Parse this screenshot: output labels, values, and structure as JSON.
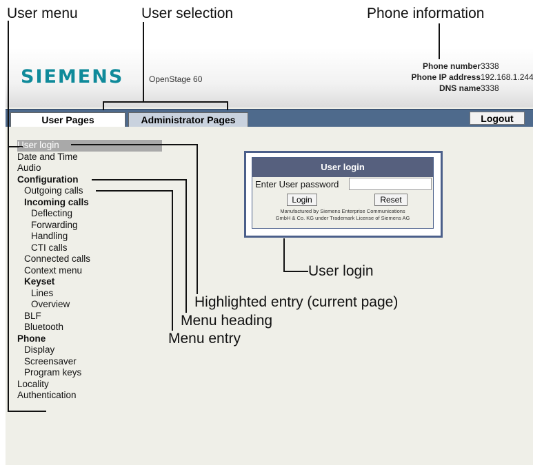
{
  "callouts": {
    "user_menu": "User menu",
    "user_selection": "User selection",
    "phone_information": "Phone information",
    "user_login": "User login",
    "highlighted_entry": "Highlighted entry (current page)",
    "menu_heading": "Menu heading",
    "menu_entry": "Menu entry"
  },
  "header": {
    "logo": "SIEMENS",
    "model": "OpenStage 60",
    "phone_info": [
      {
        "label": "Phone number",
        "value": "3338"
      },
      {
        "label": "Phone IP address",
        "value": "192.168.1.244"
      },
      {
        "label": "DNS name",
        "value": "3338"
      }
    ]
  },
  "tabs": {
    "user_pages": "User Pages",
    "admin_pages": "Administrator Pages",
    "logout": "Logout"
  },
  "menu": {
    "items": [
      {
        "label": "User login",
        "level": 1,
        "bold": false,
        "highlighted": true
      },
      {
        "label": "Date and Time",
        "level": 1,
        "bold": false,
        "highlighted": false
      },
      {
        "label": "Audio",
        "level": 1,
        "bold": false,
        "highlighted": false
      },
      {
        "label": "Configuration",
        "level": 1,
        "bold": true,
        "highlighted": false
      },
      {
        "label": "Outgoing calls",
        "level": 2,
        "bold": false,
        "highlighted": false
      },
      {
        "label": "Incoming calls",
        "level": 2,
        "bold": true,
        "highlighted": false
      },
      {
        "label": "Deflecting",
        "level": 3,
        "bold": false,
        "highlighted": false
      },
      {
        "label": "Forwarding",
        "level": 3,
        "bold": false,
        "highlighted": false
      },
      {
        "label": "Handling",
        "level": 3,
        "bold": false,
        "highlighted": false
      },
      {
        "label": "CTI calls",
        "level": 3,
        "bold": false,
        "highlighted": false
      },
      {
        "label": "Connected calls",
        "level": 2,
        "bold": false,
        "highlighted": false
      },
      {
        "label": "Context menu",
        "level": 2,
        "bold": false,
        "highlighted": false
      },
      {
        "label": "Keyset",
        "level": 2,
        "bold": true,
        "highlighted": false
      },
      {
        "label": "Lines",
        "level": 3,
        "bold": false,
        "highlighted": false
      },
      {
        "label": "Overview",
        "level": 3,
        "bold": false,
        "highlighted": false
      },
      {
        "label": "BLF",
        "level": 2,
        "bold": false,
        "highlighted": false
      },
      {
        "label": "Bluetooth",
        "level": 2,
        "bold": false,
        "highlighted": false
      },
      {
        "label": "Phone",
        "level": 1,
        "bold": true,
        "highlighted": false
      },
      {
        "label": "Display",
        "level": 2,
        "bold": false,
        "highlighted": false
      },
      {
        "label": "Screensaver",
        "level": 2,
        "bold": false,
        "highlighted": false
      },
      {
        "label": "Program keys",
        "level": 2,
        "bold": false,
        "highlighted": false
      },
      {
        "label": "Locality",
        "level": 1,
        "bold": false,
        "highlighted": false
      },
      {
        "label": "Authentication",
        "level": 1,
        "bold": false,
        "highlighted": false
      }
    ]
  },
  "login": {
    "title": "User login",
    "password_label": "Enter User password",
    "password_value": "",
    "login_button": "Login",
    "reset_button": "Reset",
    "fine_print_1": "Manufactured by Siemens Enterprise Communications",
    "fine_print_2": "GmbH & Co. KG under Trademark License of Siemens AG"
  }
}
